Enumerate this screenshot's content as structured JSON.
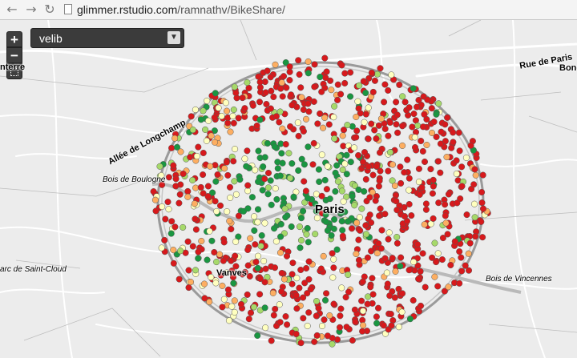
{
  "browser": {
    "url_host": "glimmer.rstudio.com",
    "url_path": "/ramnathv/BikeShare/",
    "back_icon": "back-arrow-icon",
    "forward_icon": "forward-arrow-icon",
    "reload_icon": "reload-icon"
  },
  "map": {
    "zoom_in_label": "+",
    "zoom_out_label": "−",
    "layer_select": {
      "value": "velib",
      "arrow_icon": "chevron-down-icon"
    },
    "labels": {
      "nanterre": "nterre",
      "rue_de_paris": "Rue de Paris",
      "bondy": "Bond",
      "allee": "Allée de Longchamp",
      "bois_boulogne": "Bois de Boulogne",
      "paris": "Paris",
      "saint_cloud": "arc de Saint-Cloud",
      "vanves": "Vanves",
      "bois_vincennes": "Bois de Vincennes"
    },
    "station_colors": {
      "empty": "#d7191c",
      "low": "#fdae61",
      "mid": "#ffffbf",
      "high": "#a6d96a",
      "full": "#1a9641"
    }
  }
}
